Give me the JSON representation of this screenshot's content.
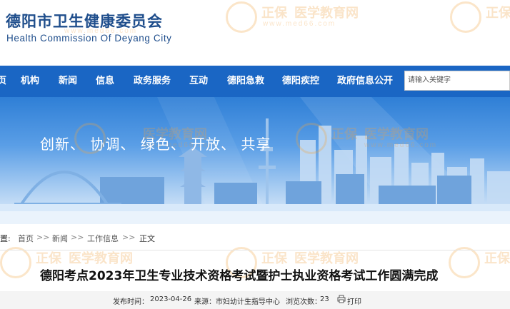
{
  "header": {
    "org_name_cn": "德阳市卫生健康委员会",
    "org_name_en": "Health Commission Of Deyang City"
  },
  "watermark": {
    "brand": "正保",
    "site": "医学教育网",
    "url": "www.med66.com"
  },
  "nav": {
    "items": [
      {
        "label": "页"
      },
      {
        "label": "机构"
      },
      {
        "label": "新闻"
      },
      {
        "label": "信息"
      },
      {
        "label": "政务服务"
      },
      {
        "label": "互动"
      },
      {
        "label": "德阳急救"
      },
      {
        "label": "德阳疾控"
      },
      {
        "label": "政府信息公开"
      }
    ],
    "search_placeholder": "请输入关键字"
  },
  "banner": {
    "slogan": "创新、 协调、 绿色、 开放、 共享"
  },
  "breadcrumb": {
    "prefix": "置:",
    "items": [
      "首页",
      "新闻",
      "工作信息",
      "正文"
    ],
    "separator": ">>"
  },
  "article": {
    "title": "德阳考点2023年卫生专业技术资格考试暨护士执业资格考试工作圆满完成",
    "publish_label": "发布时间：",
    "publish_date": "2023-04-26",
    "source_label": "来源：",
    "source": "市妇幼计生指导中心",
    "views_label": "浏览次数：",
    "views": "23",
    "print_label": "打印"
  },
  "colors": {
    "brand_blue": "#1a66c4",
    "title_blue": "#1f4e8c",
    "watermark_orange": "#f0a040"
  }
}
